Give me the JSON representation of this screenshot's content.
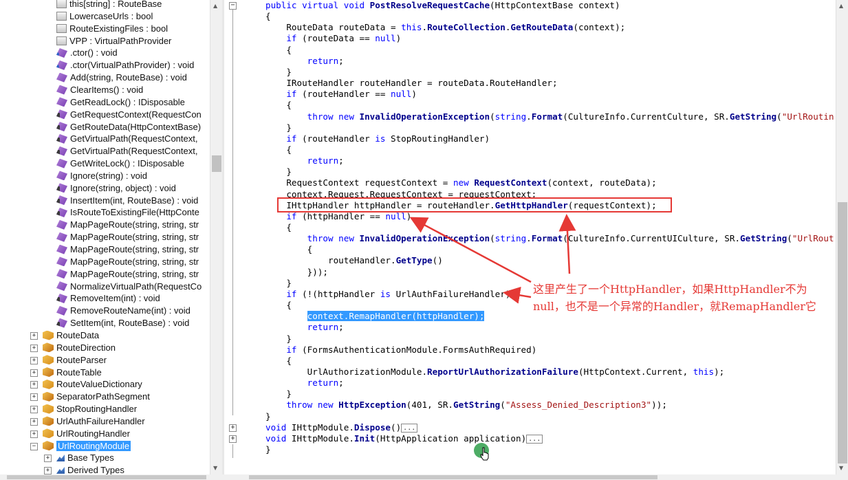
{
  "tree": {
    "members": [
      {
        "label": "this[string] : RouteBase",
        "icon": "property-icon"
      },
      {
        "label": "LowercaseUrls : bool",
        "icon": "property-icon"
      },
      {
        "label": "RouteExistingFiles : bool",
        "icon": "property-icon"
      },
      {
        "label": "VPP : VirtualPathProvider",
        "icon": "property-icon"
      },
      {
        "label": ".ctor() : void",
        "icon": "method-icon"
      },
      {
        "label": ".ctor(VirtualPathProvider) : void",
        "icon": "method-icon"
      },
      {
        "label": "Add(string, RouteBase) : void",
        "icon": "method-icon"
      },
      {
        "label": "ClearItems() : void",
        "icon": "method-icon"
      },
      {
        "label": "GetReadLock() : IDisposable",
        "icon": "method-icon"
      },
      {
        "label": "GetRequestContext(RequestCon",
        "icon": "method-icon"
      },
      {
        "label": "GetRouteData(HttpContextBase)",
        "icon": "method-icon"
      },
      {
        "label": "GetVirtualPath(RequestContext,",
        "icon": "method-icon"
      },
      {
        "label": "GetVirtualPath(RequestContext,",
        "icon": "method-icon"
      },
      {
        "label": "GetWriteLock() : IDisposable",
        "icon": "method-icon"
      },
      {
        "label": "Ignore(string) : void",
        "icon": "method-icon"
      },
      {
        "label": "Ignore(string, object) : void",
        "icon": "method-icon"
      },
      {
        "label": "InsertItem(int, RouteBase) : void",
        "icon": "method-icon"
      },
      {
        "label": "IsRouteToExistingFile(HttpConte",
        "icon": "method-icon"
      },
      {
        "label": "MapPageRoute(string, string, str",
        "icon": "method-icon"
      },
      {
        "label": "MapPageRoute(string, string, str",
        "icon": "method-icon"
      },
      {
        "label": "MapPageRoute(string, string, str",
        "icon": "method-icon"
      },
      {
        "label": "MapPageRoute(string, string, str",
        "icon": "method-icon"
      },
      {
        "label": "MapPageRoute(string, string, str",
        "icon": "method-icon"
      },
      {
        "label": "NormalizeVirtualPath(RequestCo",
        "icon": "method-icon"
      },
      {
        "label": "RemoveItem(int) : void",
        "icon": "method-icon"
      },
      {
        "label": "RemoveRouteName(int) : void",
        "icon": "method-icon"
      },
      {
        "label": "SetItem(int, RouteBase) : void",
        "icon": "method-icon"
      }
    ],
    "types": [
      {
        "label": "RouteData"
      },
      {
        "label": "RouteDirection"
      },
      {
        "label": "RouteParser"
      },
      {
        "label": "RouteTable"
      },
      {
        "label": "RouteValueDictionary"
      },
      {
        "label": "SeparatorPathSegment"
      },
      {
        "label": "StopRoutingHandler"
      },
      {
        "label": "UrlAuthFailureHandler"
      },
      {
        "label": "UrlRoutingHandler"
      },
      {
        "label": "UrlRoutingModule",
        "selected": true
      }
    ],
    "children": [
      {
        "label": "Base Types"
      },
      {
        "label": "Derived Types"
      }
    ]
  },
  "code": {
    "lines": [
      [
        [
          "kw",
          "public virtual void "
        ],
        [
          "mn",
          "PostResolveRequestCache"
        ],
        [
          "t",
          "(HttpContextBase context)"
        ]
      ],
      [
        [
          "t",
          "{"
        ]
      ],
      [
        [
          "t",
          "    RouteData routeData = "
        ],
        [
          "kw",
          "this"
        ],
        [
          "t",
          "."
        ],
        [
          "mn",
          "RouteCollection"
        ],
        [
          "t",
          "."
        ],
        [
          "mn",
          "GetRouteData"
        ],
        [
          "t",
          "(context);"
        ]
      ],
      [
        [
          "t",
          "    "
        ],
        [
          "kw",
          "if"
        ],
        [
          "t",
          " (routeData == "
        ],
        [
          "kw",
          "null"
        ],
        [
          "t",
          ")"
        ]
      ],
      [
        [
          "t",
          "    {"
        ]
      ],
      [
        [
          "t",
          "        "
        ],
        [
          "kw",
          "return"
        ],
        [
          "t",
          ";"
        ]
      ],
      [
        [
          "t",
          "    }"
        ]
      ],
      [
        [
          "t",
          "    IRouteHandler routeHandler = routeData.RouteHandler;"
        ]
      ],
      [
        [
          "t",
          "    "
        ],
        [
          "kw",
          "if"
        ],
        [
          "t",
          " (routeHandler == "
        ],
        [
          "kw",
          "null"
        ],
        [
          "t",
          ")"
        ]
      ],
      [
        [
          "t",
          "    {"
        ]
      ],
      [
        [
          "t",
          "        "
        ],
        [
          "kw",
          "throw new "
        ],
        [
          "mn",
          "InvalidOperationException"
        ],
        [
          "t",
          "("
        ],
        [
          "kw",
          "string"
        ],
        [
          "t",
          "."
        ],
        [
          "mn",
          "Format"
        ],
        [
          "t",
          "(CultureInfo.CurrentCulture, SR."
        ],
        [
          "mn",
          "GetString"
        ],
        [
          "t",
          "("
        ],
        [
          "str",
          "\"UrlRoutin"
        ]
      ],
      [
        [
          "t",
          "    }"
        ]
      ],
      [
        [
          "t",
          "    "
        ],
        [
          "kw",
          "if"
        ],
        [
          "t",
          " (routeHandler "
        ],
        [
          "kw",
          "is"
        ],
        [
          "t",
          " StopRoutingHandler)"
        ]
      ],
      [
        [
          "t",
          "    {"
        ]
      ],
      [
        [
          "t",
          "        "
        ],
        [
          "kw",
          "return"
        ],
        [
          "t",
          ";"
        ]
      ],
      [
        [
          "t",
          "    }"
        ]
      ],
      [
        [
          "t",
          "    RequestContext requestContext = "
        ],
        [
          "kw",
          "new "
        ],
        [
          "mn",
          "RequestContext"
        ],
        [
          "t",
          "(context, routeData);"
        ]
      ],
      [
        [
          "t",
          "    context.Request.RequestContext = requestContext;"
        ]
      ],
      [
        [
          "t",
          "    IHttpHandler httpHandler = routeHandler."
        ],
        [
          "mn",
          "GetHttpHandler"
        ],
        [
          "t",
          "(requestContext);"
        ]
      ],
      [
        [
          "t",
          "    "
        ],
        [
          "kw",
          "if"
        ],
        [
          "t",
          " (httpHandler == "
        ],
        [
          "kw",
          "null"
        ],
        [
          "t",
          ")"
        ]
      ],
      [
        [
          "t",
          "    {"
        ]
      ],
      [
        [
          "t",
          "        "
        ],
        [
          "kw",
          "throw new "
        ],
        [
          "mn",
          "InvalidOperationException"
        ],
        [
          "t",
          "("
        ],
        [
          "kw",
          "string"
        ],
        [
          "t",
          "."
        ],
        [
          "mn",
          "Format"
        ],
        [
          "t",
          "(CultureInfo.CurrentUICulture, SR."
        ],
        [
          "mn",
          "GetString"
        ],
        [
          "t",
          "("
        ],
        [
          "str",
          "\"UrlRout"
        ]
      ],
      [
        [
          "t",
          "        {"
        ]
      ],
      [
        [
          "t",
          "            routeHandler."
        ],
        [
          "mn",
          "GetType"
        ],
        [
          "t",
          "()"
        ]
      ],
      [
        [
          "t",
          "        }));"
        ]
      ],
      [
        [
          "t",
          "    }"
        ]
      ],
      [
        [
          "t",
          "    "
        ],
        [
          "kw",
          "if"
        ],
        [
          "t",
          " (!(httpHandler "
        ],
        [
          "kw",
          "is"
        ],
        [
          "t",
          " UrlAuthFailureHandler))"
        ]
      ],
      [
        [
          "t",
          "    {"
        ]
      ],
      [
        [
          "t",
          "        "
        ],
        [
          "hl",
          "context.RemapHandler(httpHandler);"
        ]
      ],
      [
        [
          "t",
          "        "
        ],
        [
          "kw",
          "return"
        ],
        [
          "t",
          ";"
        ]
      ],
      [
        [
          "t",
          "    }"
        ]
      ],
      [
        [
          "t",
          "    "
        ],
        [
          "kw",
          "if"
        ],
        [
          "t",
          " (FormsAuthenticationModule.FormsAuthRequired)"
        ]
      ],
      [
        [
          "t",
          "    {"
        ]
      ],
      [
        [
          "t",
          "        UrlAuthorizationModule."
        ],
        [
          "mn",
          "ReportUrlAuthorizationFailure"
        ],
        [
          "t",
          "(HttpContext.Current, "
        ],
        [
          "kw",
          "this"
        ],
        [
          "t",
          ");"
        ]
      ],
      [
        [
          "t",
          "        "
        ],
        [
          "kw",
          "return"
        ],
        [
          "t",
          ";"
        ]
      ],
      [
        [
          "t",
          "    }"
        ]
      ],
      [
        [
          "t",
          "    "
        ],
        [
          "kw",
          "throw new "
        ],
        [
          "mn",
          "HttpException"
        ],
        [
          "t",
          "(401, SR."
        ],
        [
          "mn",
          "GetString"
        ],
        [
          "t",
          "("
        ],
        [
          "str",
          "\"Assess_Denied_Description3\""
        ],
        [
          "t",
          "));"
        ]
      ],
      [
        [
          "t",
          "}"
        ]
      ],
      [
        [
          "kw",
          "void "
        ],
        [
          "t",
          "IHttpModule."
        ],
        [
          "mn",
          "Dispose"
        ],
        [
          "t",
          "()"
        ],
        [
          "dots",
          "..."
        ]
      ],
      [
        [
          "kw",
          "void "
        ],
        [
          "t",
          "IHttpModule."
        ],
        [
          "mn",
          "Init"
        ],
        [
          "t",
          "(HttpApplication application)"
        ],
        [
          "dots",
          "..."
        ]
      ],
      [
        [
          "t",
          "}"
        ]
      ]
    ]
  },
  "annotation": {
    "text": "这里产生了一个HttpHandler，如果HttpHandler不为null，也不是一个异常的Handler，就RemapHandler它",
    "color": "#e53935"
  }
}
